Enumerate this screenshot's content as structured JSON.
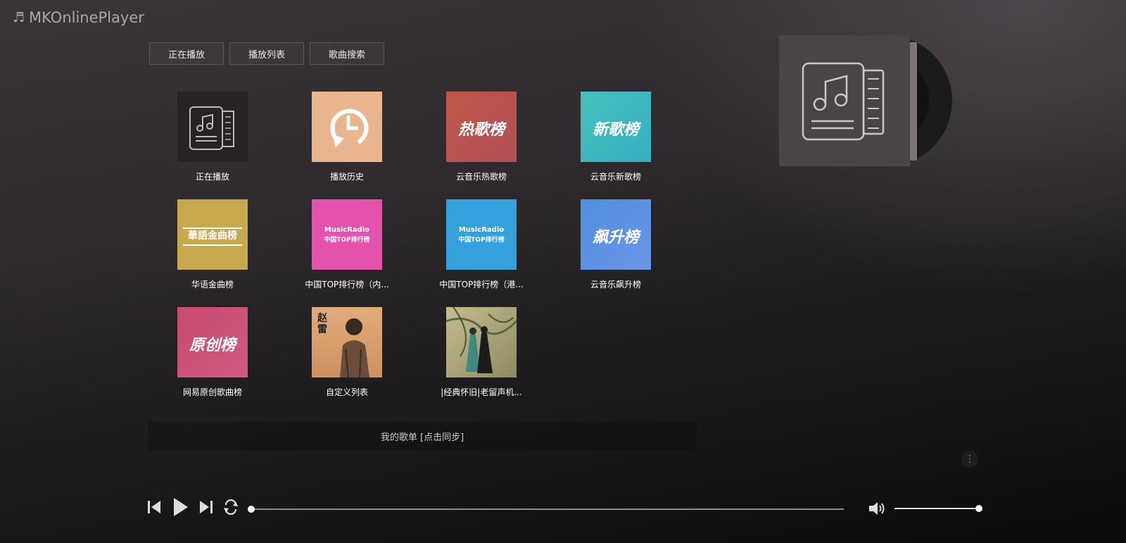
{
  "app": {
    "title": "MKOnlinePlayer",
    "logo_glyph": "♬"
  },
  "tabs": [
    {
      "label": "正在播放"
    },
    {
      "label": "播放列表"
    },
    {
      "label": "歌曲搜索"
    }
  ],
  "playlists": [
    {
      "label": "正在播放",
      "cover_text": "",
      "cover_color": "#262225"
    },
    {
      "label": "播放历史",
      "cover_text": "",
      "cover_color": "#e9b58e"
    },
    {
      "label": "云音乐热歌榜",
      "cover_text": "热歌榜",
      "cover_color": "#b9554d"
    },
    {
      "label": "云音乐新歌榜",
      "cover_text": "新歌榜",
      "cover_color": "#3fb9b9"
    },
    {
      "label": "华语金曲榜",
      "cover_text": "華語金曲榜",
      "cover_color": "#c7a84e"
    },
    {
      "label": "中国TOP排行榜（内...",
      "cover_text": "MusicRadio",
      "cover_sub": "中国TOP排行榜",
      "cover_color": "#e34fa9"
    },
    {
      "label": "中国TOP排行榜（港...",
      "cover_text": "MusicRadio",
      "cover_sub": "中国TOP排行榜",
      "cover_color": "#34a0dc"
    },
    {
      "label": "云音乐飙升榜",
      "cover_text": "飙升榜",
      "cover_color": "#5a8fdc"
    },
    {
      "label": "网易原创歌曲榜",
      "cover_text": "原创榜",
      "cover_color": "#d04a76"
    },
    {
      "label": "自定义列表",
      "cover_text": "赵雷",
      "cover_color": "#d8a070"
    },
    {
      "label": "|经典怀旧|老留声机...",
      "cover_text": "",
      "cover_color": "#a89a70"
    }
  ],
  "sync": {
    "label": "我的歌单 [点击同步]"
  },
  "player": {
    "progress": 0,
    "volume": 1.0,
    "icons": [
      "prev-icon",
      "play-icon",
      "next-icon",
      "loop-icon",
      "volume-icon"
    ]
  },
  "more_icon": "⋮"
}
